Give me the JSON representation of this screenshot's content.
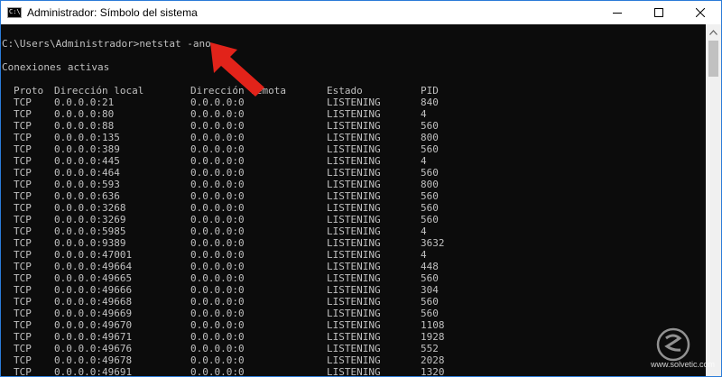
{
  "window": {
    "title": "Administrador: Símbolo del sistema",
    "icon_label": "C:\\",
    "controls": [
      "minimize-icon",
      "maximize-icon",
      "close-icon"
    ]
  },
  "console": {
    "prompt": "C:\\Users\\Administrador>netstat -ano",
    "heading": "Conexiones activas",
    "columns": {
      "proto": "Proto",
      "local": "Dirección local",
      "remote": "Dirección remota",
      "state": "Estado",
      "pid": "PID"
    },
    "rows": [
      {
        "proto": "TCP",
        "local": "0.0.0.0:21",
        "remote": "0.0.0.0:0",
        "state": "LISTENING",
        "pid": "840"
      },
      {
        "proto": "TCP",
        "local": "0.0.0.0:80",
        "remote": "0.0.0.0:0",
        "state": "LISTENING",
        "pid": "4"
      },
      {
        "proto": "TCP",
        "local": "0.0.0.0:88",
        "remote": "0.0.0.0:0",
        "state": "LISTENING",
        "pid": "560"
      },
      {
        "proto": "TCP",
        "local": "0.0.0.0:135",
        "remote": "0.0.0.0:0",
        "state": "LISTENING",
        "pid": "800"
      },
      {
        "proto": "TCP",
        "local": "0.0.0.0:389",
        "remote": "0.0.0.0:0",
        "state": "LISTENING",
        "pid": "560"
      },
      {
        "proto": "TCP",
        "local": "0.0.0.0:445",
        "remote": "0.0.0.0:0",
        "state": "LISTENING",
        "pid": "4"
      },
      {
        "proto": "TCP",
        "local": "0.0.0.0:464",
        "remote": "0.0.0.0:0",
        "state": "LISTENING",
        "pid": "560"
      },
      {
        "proto": "TCP",
        "local": "0.0.0.0:593",
        "remote": "0.0.0.0:0",
        "state": "LISTENING",
        "pid": "800"
      },
      {
        "proto": "TCP",
        "local": "0.0.0.0:636",
        "remote": "0.0.0.0:0",
        "state": "LISTENING",
        "pid": "560"
      },
      {
        "proto": "TCP",
        "local": "0.0.0.0:3268",
        "remote": "0.0.0.0:0",
        "state": "LISTENING",
        "pid": "560"
      },
      {
        "proto": "TCP",
        "local": "0.0.0.0:3269",
        "remote": "0.0.0.0:0",
        "state": "LISTENING",
        "pid": "560"
      },
      {
        "proto": "TCP",
        "local": "0.0.0.0:5985",
        "remote": "0.0.0.0:0",
        "state": "LISTENING",
        "pid": "4"
      },
      {
        "proto": "TCP",
        "local": "0.0.0.0:9389",
        "remote": "0.0.0.0:0",
        "state": "LISTENING",
        "pid": "3632"
      },
      {
        "proto": "TCP",
        "local": "0.0.0.0:47001",
        "remote": "0.0.0.0:0",
        "state": "LISTENING",
        "pid": "4"
      },
      {
        "proto": "TCP",
        "local": "0.0.0.0:49664",
        "remote": "0.0.0.0:0",
        "state": "LISTENING",
        "pid": "448"
      },
      {
        "proto": "TCP",
        "local": "0.0.0.0:49665",
        "remote": "0.0.0.0:0",
        "state": "LISTENING",
        "pid": "560"
      },
      {
        "proto": "TCP",
        "local": "0.0.0.0:49666",
        "remote": "0.0.0.0:0",
        "state": "LISTENING",
        "pid": "304"
      },
      {
        "proto": "TCP",
        "local": "0.0.0.0:49668",
        "remote": "0.0.0.0:0",
        "state": "LISTENING",
        "pid": "560"
      },
      {
        "proto": "TCP",
        "local": "0.0.0.0:49669",
        "remote": "0.0.0.0:0",
        "state": "LISTENING",
        "pid": "560"
      },
      {
        "proto": "TCP",
        "local": "0.0.0.0:49670",
        "remote": "0.0.0.0:0",
        "state": "LISTENING",
        "pid": "1108"
      },
      {
        "proto": "TCP",
        "local": "0.0.0.0:49671",
        "remote": "0.0.0.0:0",
        "state": "LISTENING",
        "pid": "1928"
      },
      {
        "proto": "TCP",
        "local": "0.0.0.0:49676",
        "remote": "0.0.0.0:0",
        "state": "LISTENING",
        "pid": "552"
      },
      {
        "proto": "TCP",
        "local": "0.0.0.0:49678",
        "remote": "0.0.0.0:0",
        "state": "LISTENING",
        "pid": "2028"
      },
      {
        "proto": "TCP",
        "local": "0.0.0.0:49691",
        "remote": "0.0.0.0:0",
        "state": "LISTENING",
        "pid": "1320"
      }
    ]
  },
  "annotation": {
    "arrow_icon": "red-arrow-icon",
    "color": "#e2231a"
  },
  "watermark": {
    "text": "www.solvetic.com",
    "icon": "solvetic-logo-icon"
  },
  "colors": {
    "console_bg": "#0c0c0c",
    "console_fg": "#c0c0c0",
    "window_border": "#2b7bd8"
  }
}
